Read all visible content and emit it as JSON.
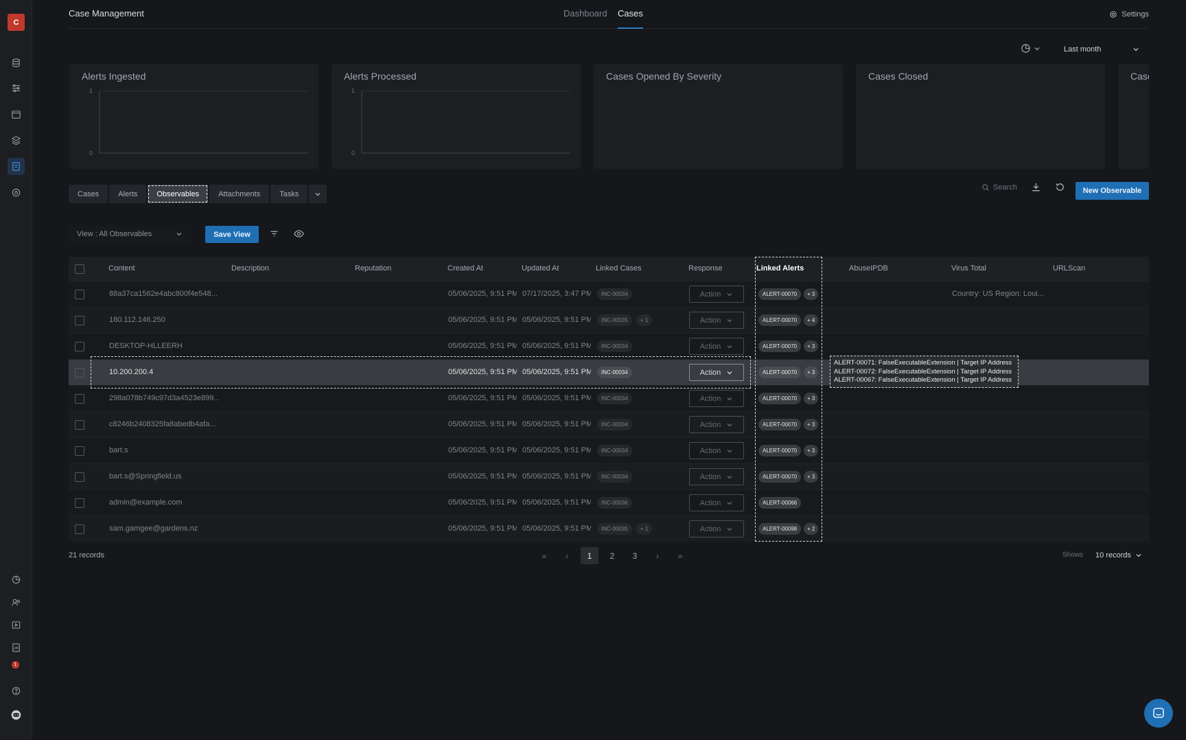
{
  "app": {
    "logo_letter": "C",
    "title": "Case Management"
  },
  "nav": {
    "tabs": [
      "Dashboard",
      "Cases"
    ],
    "active": "Cases"
  },
  "settings_label": "Settings",
  "period": {
    "selected": "Last month"
  },
  "cards": [
    {
      "title": "Alerts Ingested",
      "y_ticks": [
        "1",
        "0"
      ]
    },
    {
      "title": "Alerts Processed",
      "y_ticks": [
        "1",
        "0"
      ]
    },
    {
      "title": "Cases Opened By Severity"
    },
    {
      "title": "Cases Closed"
    },
    {
      "title": "Case"
    }
  ],
  "subtabs": [
    "Cases",
    "Alerts",
    "Observables",
    "Attachments",
    "Tasks"
  ],
  "active_subtab": "Observables",
  "search_placeholder": "Search",
  "new_button": "New Observable",
  "view": {
    "label": "View : All Observables",
    "save_label": "Save View"
  },
  "columns": [
    "Content",
    "Description",
    "Reputation",
    "Created At",
    "Updated At",
    "Linked Cases",
    "Response",
    "Linked Alerts",
    "AbuseIPDB",
    "Virus Total",
    "URLScan"
  ],
  "action_label": "Action",
  "rows": [
    {
      "content": "88a37ca1562e4abc800f4e548...",
      "created": "05/06/2025, 9:51 PM",
      "updated": "07/17/2025, 3:47 PM",
      "case": "INC-00034",
      "case_extra": "",
      "alert": "ALERT-00070",
      "alert_extra": "+ 3",
      "virustotal": "Country: US Region: Loui..."
    },
    {
      "content": "180.112.146.250",
      "created": "05/06/2025, 9:51 PM",
      "updated": "05/06/2025, 9:51 PM",
      "case": "INC-00035",
      "case_extra": "+ 1",
      "alert": "ALERT-00070",
      "alert_extra": "+ 4",
      "virustotal": ""
    },
    {
      "content": "DESKTOP-HLLEERH",
      "created": "05/06/2025, 9:51 PM",
      "updated": "05/06/2025, 9:51 PM",
      "case": "INC-00034",
      "case_extra": "",
      "alert": "ALERT-00070",
      "alert_extra": "+ 3",
      "virustotal": ""
    },
    {
      "content": "10.200.200.4",
      "created": "05/06/2025, 9:51 PM",
      "updated": "05/06/2025, 9:51 PM",
      "case": "INC-00034",
      "case_extra": "",
      "alert": "ALERT-00070",
      "alert_extra": "+ 3",
      "virustotal": "",
      "selected": true
    },
    {
      "content": "298a078b749c97d3a4523e899...",
      "created": "05/06/2025, 9:51 PM",
      "updated": "05/06/2025, 9:51 PM",
      "case": "INC-00034",
      "case_extra": "",
      "alert": "ALERT-00070",
      "alert_extra": "+ 3",
      "virustotal": ""
    },
    {
      "content": "c8246b2408325fa8abedb4afa...",
      "created": "05/06/2025, 9:51 PM",
      "updated": "05/06/2025, 9:51 PM",
      "case": "INC-00034",
      "case_extra": "",
      "alert": "ALERT-00070",
      "alert_extra": "+ 3",
      "virustotal": ""
    },
    {
      "content": "bart.s",
      "created": "05/06/2025, 9:51 PM",
      "updated": "05/06/2025, 9:51 PM",
      "case": "INC-00034",
      "case_extra": "",
      "alert": "ALERT-00070",
      "alert_extra": "+ 3",
      "virustotal": ""
    },
    {
      "content": "bart.s@Springfield.us",
      "created": "05/06/2025, 9:51 PM",
      "updated": "05/06/2025, 9:51 PM",
      "case": "INC-00034",
      "case_extra": "",
      "alert": "ALERT-00070",
      "alert_extra": "+ 3",
      "virustotal": ""
    },
    {
      "content": "admin@example.com",
      "created": "05/06/2025, 9:51 PM",
      "updated": "05/06/2025, 9:51 PM",
      "case": "INC-00036",
      "case_extra": "",
      "alert": "ALERT-00066",
      "alert_extra": "",
      "virustotal": ""
    },
    {
      "content": "sam.gamgee@gardens.nz",
      "created": "05/06/2025, 9:51 PM",
      "updated": "05/06/2025, 9:51 PM",
      "case": "INC-00035",
      "case_extra": "+ 1",
      "alert": "ALERT-00098",
      "alert_extra": "+ 2",
      "virustotal": ""
    }
  ],
  "tooltip": {
    "lines": [
      "ALERT-00071: FalseExecutableExtension | Target IP Address",
      "ALERT-00072: FalseExecutableExtension | Target IP Address",
      "ALERT-00067: FalseExecutableExtension | Target IP Address"
    ]
  },
  "footer": {
    "records": "21 records",
    "pages": [
      "1",
      "2",
      "3"
    ],
    "current_page": "1",
    "shows_label": "Shows",
    "per_page": "10 records"
  },
  "notification_count": "1",
  "colors": {
    "accent": "#1f6fb5",
    "logo": "#c0392b",
    "background": "#15171b"
  }
}
